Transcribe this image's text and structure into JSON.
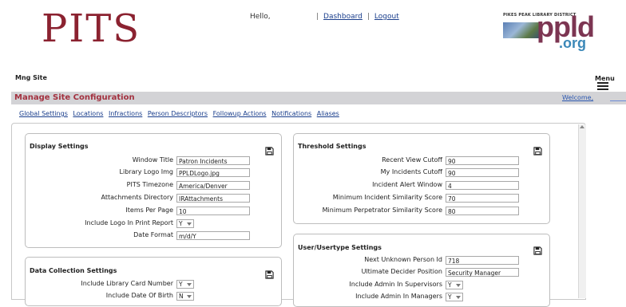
{
  "header": {
    "app_logo": "PITS",
    "greeting": "Hello,",
    "nav": {
      "dashboard": "Dashboard",
      "logout": "Logout",
      "separator": "|"
    },
    "district_logo": {
      "line1": "PIKES PEAK LIBRARY DISTRICT",
      "word": "ppld",
      "tld": ".org"
    }
  },
  "site_label": "Mng Site",
  "menu_label": "Menu",
  "page_title": "Manage Site Configuration",
  "welcome_link": "Welcome,",
  "subnav": [
    "Global Settings",
    "Locations",
    "Infractions",
    "Person Descriptors",
    "Followup Actions",
    "Notifications",
    "Aliases"
  ],
  "display_settings": {
    "title": "Display Settings",
    "fields": [
      {
        "label": "Window Title",
        "value": "Patron Incidents"
      },
      {
        "label": "Library Logo Img",
        "value": "PPLDLogo.jpg"
      },
      {
        "label": "PITS Timezone",
        "value": "America/Denver"
      },
      {
        "label": "Attachments Directory",
        "value": "IRAttachments"
      },
      {
        "label": "Items Per Page",
        "value": "10"
      },
      {
        "label": "Include Logo In Print Report",
        "value": "Y"
      },
      {
        "label": "Date Format",
        "value": "m/d/Y"
      }
    ]
  },
  "data_collection_settings": {
    "title": "Data Collection Settings",
    "fields": [
      {
        "label": "Include Library Card Number",
        "value": "Y"
      },
      {
        "label": "Include Date Of Birth",
        "value": "N"
      }
    ]
  },
  "threshold_settings": {
    "title": "Threshold Settings",
    "fields": [
      {
        "label": "Recent View Cutoff",
        "value": "90"
      },
      {
        "label": "My Incidents Cutoff",
        "value": "90"
      },
      {
        "label": "Incident Alert Window",
        "value": "4"
      },
      {
        "label": "Minimum Incident Similarity Score",
        "value": "70"
      },
      {
        "label": "Minimum Perpetrator Similarity Score",
        "value": "80"
      }
    ]
  },
  "user_settings": {
    "title": "User/Usertype Settings",
    "fields": [
      {
        "label": "Next Unknown Person Id",
        "value": "718"
      },
      {
        "label": "Ultimate Decider Position",
        "value": "Security Manager"
      },
      {
        "label": "Include Admin In Supervisors",
        "value": "Y"
      },
      {
        "label": "Include Admin In Managers",
        "value": "Y"
      }
    ]
  },
  "colors": {
    "brand": "#8b2230",
    "link": "#1a3e8c",
    "titlebar": "#d3d3d6",
    "title_text": "#a3313f"
  }
}
